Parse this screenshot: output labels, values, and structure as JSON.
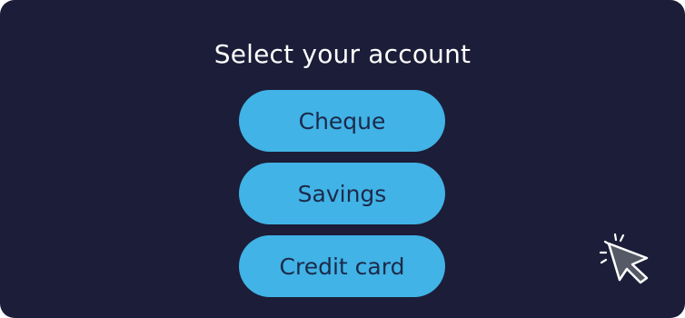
{
  "title": "Select your account",
  "options": [
    {
      "label": "Cheque"
    },
    {
      "label": "Savings"
    },
    {
      "label": "Credit card"
    }
  ],
  "icons": {
    "cursor": "pointer-click-icon"
  },
  "colors": {
    "background": "#1c1d38",
    "button": "#41b3e6",
    "button_text": "#1c2a4a",
    "title_text": "#ffffff",
    "cursor_fill": "#555a66"
  }
}
